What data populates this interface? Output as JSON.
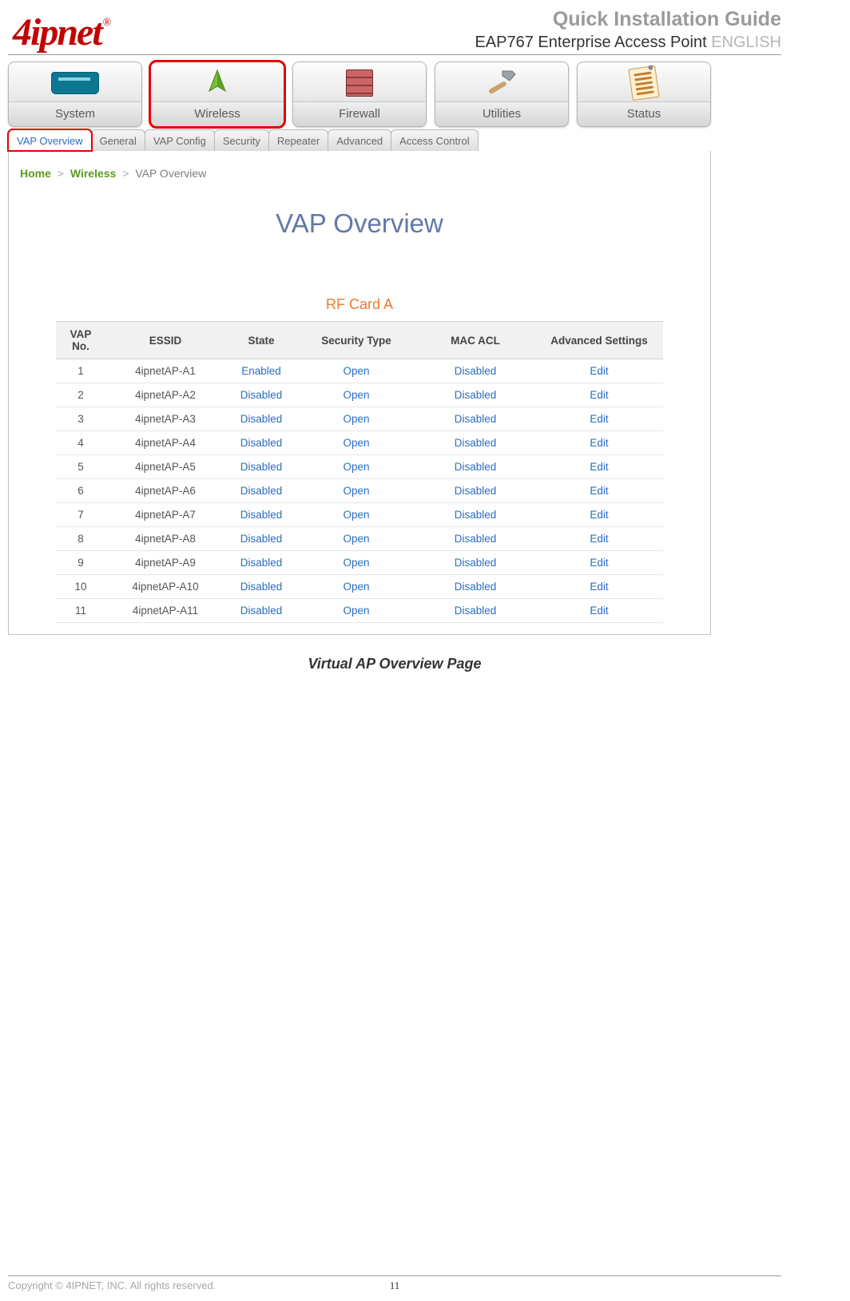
{
  "brand": {
    "name": "4ipnet",
    "reg": "®"
  },
  "header": {
    "guide": "Quick Installation Guide",
    "product": "EAP767 Enterprise Access Point",
    "lang": "ENGLISH"
  },
  "main_tabs": [
    {
      "key": "system",
      "label": "System"
    },
    {
      "key": "wireless",
      "label": "Wireless"
    },
    {
      "key": "firewall",
      "label": "Firewall"
    },
    {
      "key": "utilities",
      "label": "Utilities"
    },
    {
      "key": "status",
      "label": "Status"
    }
  ],
  "sub_tabs": [
    {
      "key": "vap-overview",
      "label": "VAP Overview",
      "active": true
    },
    {
      "key": "general",
      "label": "General"
    },
    {
      "key": "vap-config",
      "label": "VAP Config"
    },
    {
      "key": "security",
      "label": "Security"
    },
    {
      "key": "repeater",
      "label": "Repeater"
    },
    {
      "key": "advanced",
      "label": "Advanced"
    },
    {
      "key": "access-control",
      "label": "Access Control"
    }
  ],
  "breadcrumb": {
    "home": "Home",
    "section": "Wireless",
    "current": "VAP Overview",
    "sep": ">"
  },
  "pane": {
    "title": "VAP Overview",
    "rf_card": "RF Card A",
    "columns": {
      "vap_no": "VAP No.",
      "essid": "ESSID",
      "state": "State",
      "security": "Security Type",
      "mac_acl": "MAC ACL",
      "advanced": "Advanced Settings"
    },
    "edit_label": "Edit",
    "rows": [
      {
        "no": "1",
        "essid": "4ipnetAP-A1",
        "state": "Enabled",
        "security": "Open",
        "mac": "Disabled"
      },
      {
        "no": "2",
        "essid": "4ipnetAP-A2",
        "state": "Disabled",
        "security": "Open",
        "mac": "Disabled"
      },
      {
        "no": "3",
        "essid": "4ipnetAP-A3",
        "state": "Disabled",
        "security": "Open",
        "mac": "Disabled"
      },
      {
        "no": "4",
        "essid": "4ipnetAP-A4",
        "state": "Disabled",
        "security": "Open",
        "mac": "Disabled"
      },
      {
        "no": "5",
        "essid": "4ipnetAP-A5",
        "state": "Disabled",
        "security": "Open",
        "mac": "Disabled"
      },
      {
        "no": "6",
        "essid": "4ipnetAP-A6",
        "state": "Disabled",
        "security": "Open",
        "mac": "Disabled"
      },
      {
        "no": "7",
        "essid": "4ipnetAP-A7",
        "state": "Disabled",
        "security": "Open",
        "mac": "Disabled"
      },
      {
        "no": "8",
        "essid": "4ipnetAP-A8",
        "state": "Disabled",
        "security": "Open",
        "mac": "Disabled"
      },
      {
        "no": "9",
        "essid": "4ipnetAP-A9",
        "state": "Disabled",
        "security": "Open",
        "mac": "Disabled"
      },
      {
        "no": "10",
        "essid": "4ipnetAP-A10",
        "state": "Disabled",
        "security": "Open",
        "mac": "Disabled"
      },
      {
        "no": "11",
        "essid": "4ipnetAP-A11",
        "state": "Disabled",
        "security": "Open",
        "mac": "Disabled"
      }
    ]
  },
  "caption": "Virtual AP Overview Page",
  "footer": {
    "copyright": "Copyright © 4IPNET, INC. All rights reserved.",
    "page_number": "11"
  }
}
